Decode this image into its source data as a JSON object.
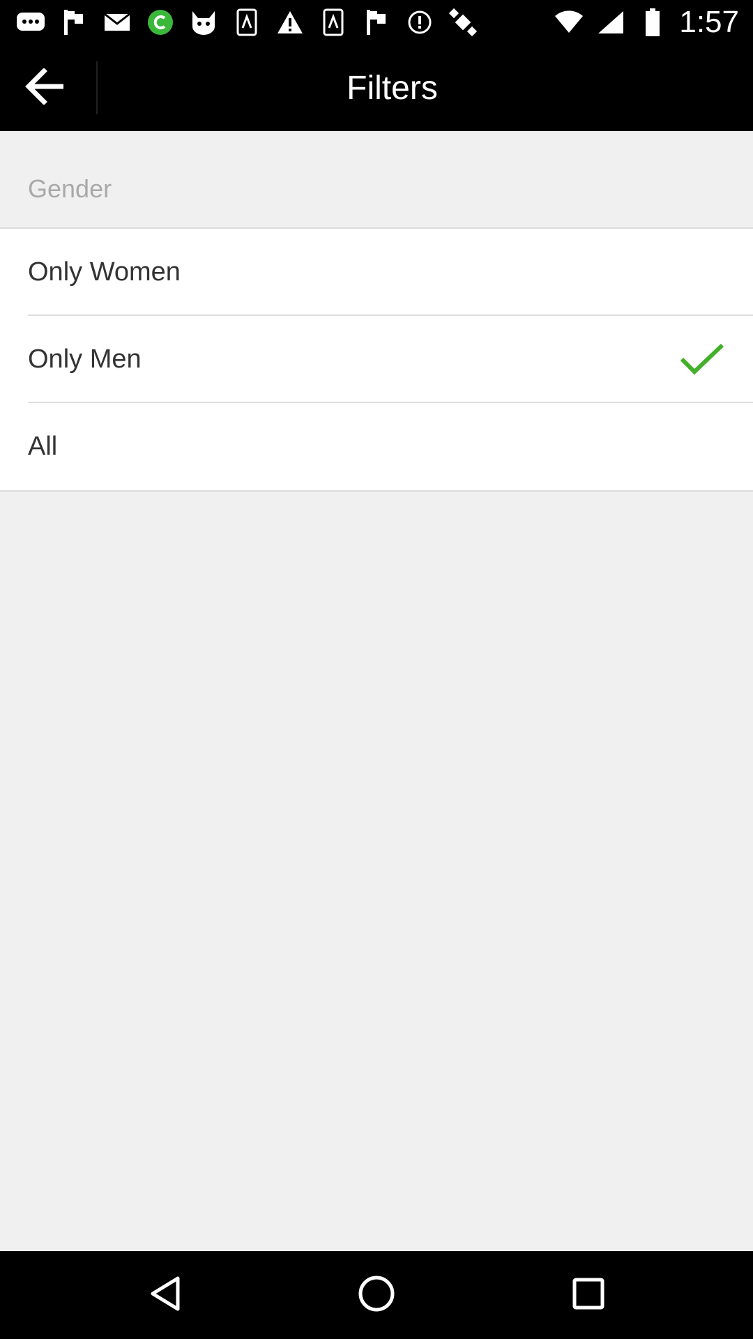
{
  "status_bar": {
    "time": "1:57",
    "icons": [
      "chat-icon",
      "flag-icon",
      "mail-icon",
      "c-app-icon",
      "cat-face-icon",
      "usb-debug-icon",
      "warning-icon",
      "usb-debug-icon",
      "flag-icon",
      "do-not-disturb-icon",
      "fake-gps-icon",
      "wifi-icon",
      "signal-icon",
      "battery-icon"
    ]
  },
  "app_bar": {
    "title": "Filters",
    "back_icon": "arrow-left-icon"
  },
  "section": {
    "title": "Gender"
  },
  "options": [
    {
      "label": "Only Women",
      "selected": false
    },
    {
      "label": "Only Men",
      "selected": true
    },
    {
      "label": "All",
      "selected": false
    }
  ],
  "colors": {
    "check": "#43b02a",
    "bars": "#000000",
    "background": "#f0f0f0"
  },
  "nav_bar": {
    "icons": [
      "back-triangle-icon",
      "home-circle-icon",
      "recents-square-icon"
    ]
  }
}
